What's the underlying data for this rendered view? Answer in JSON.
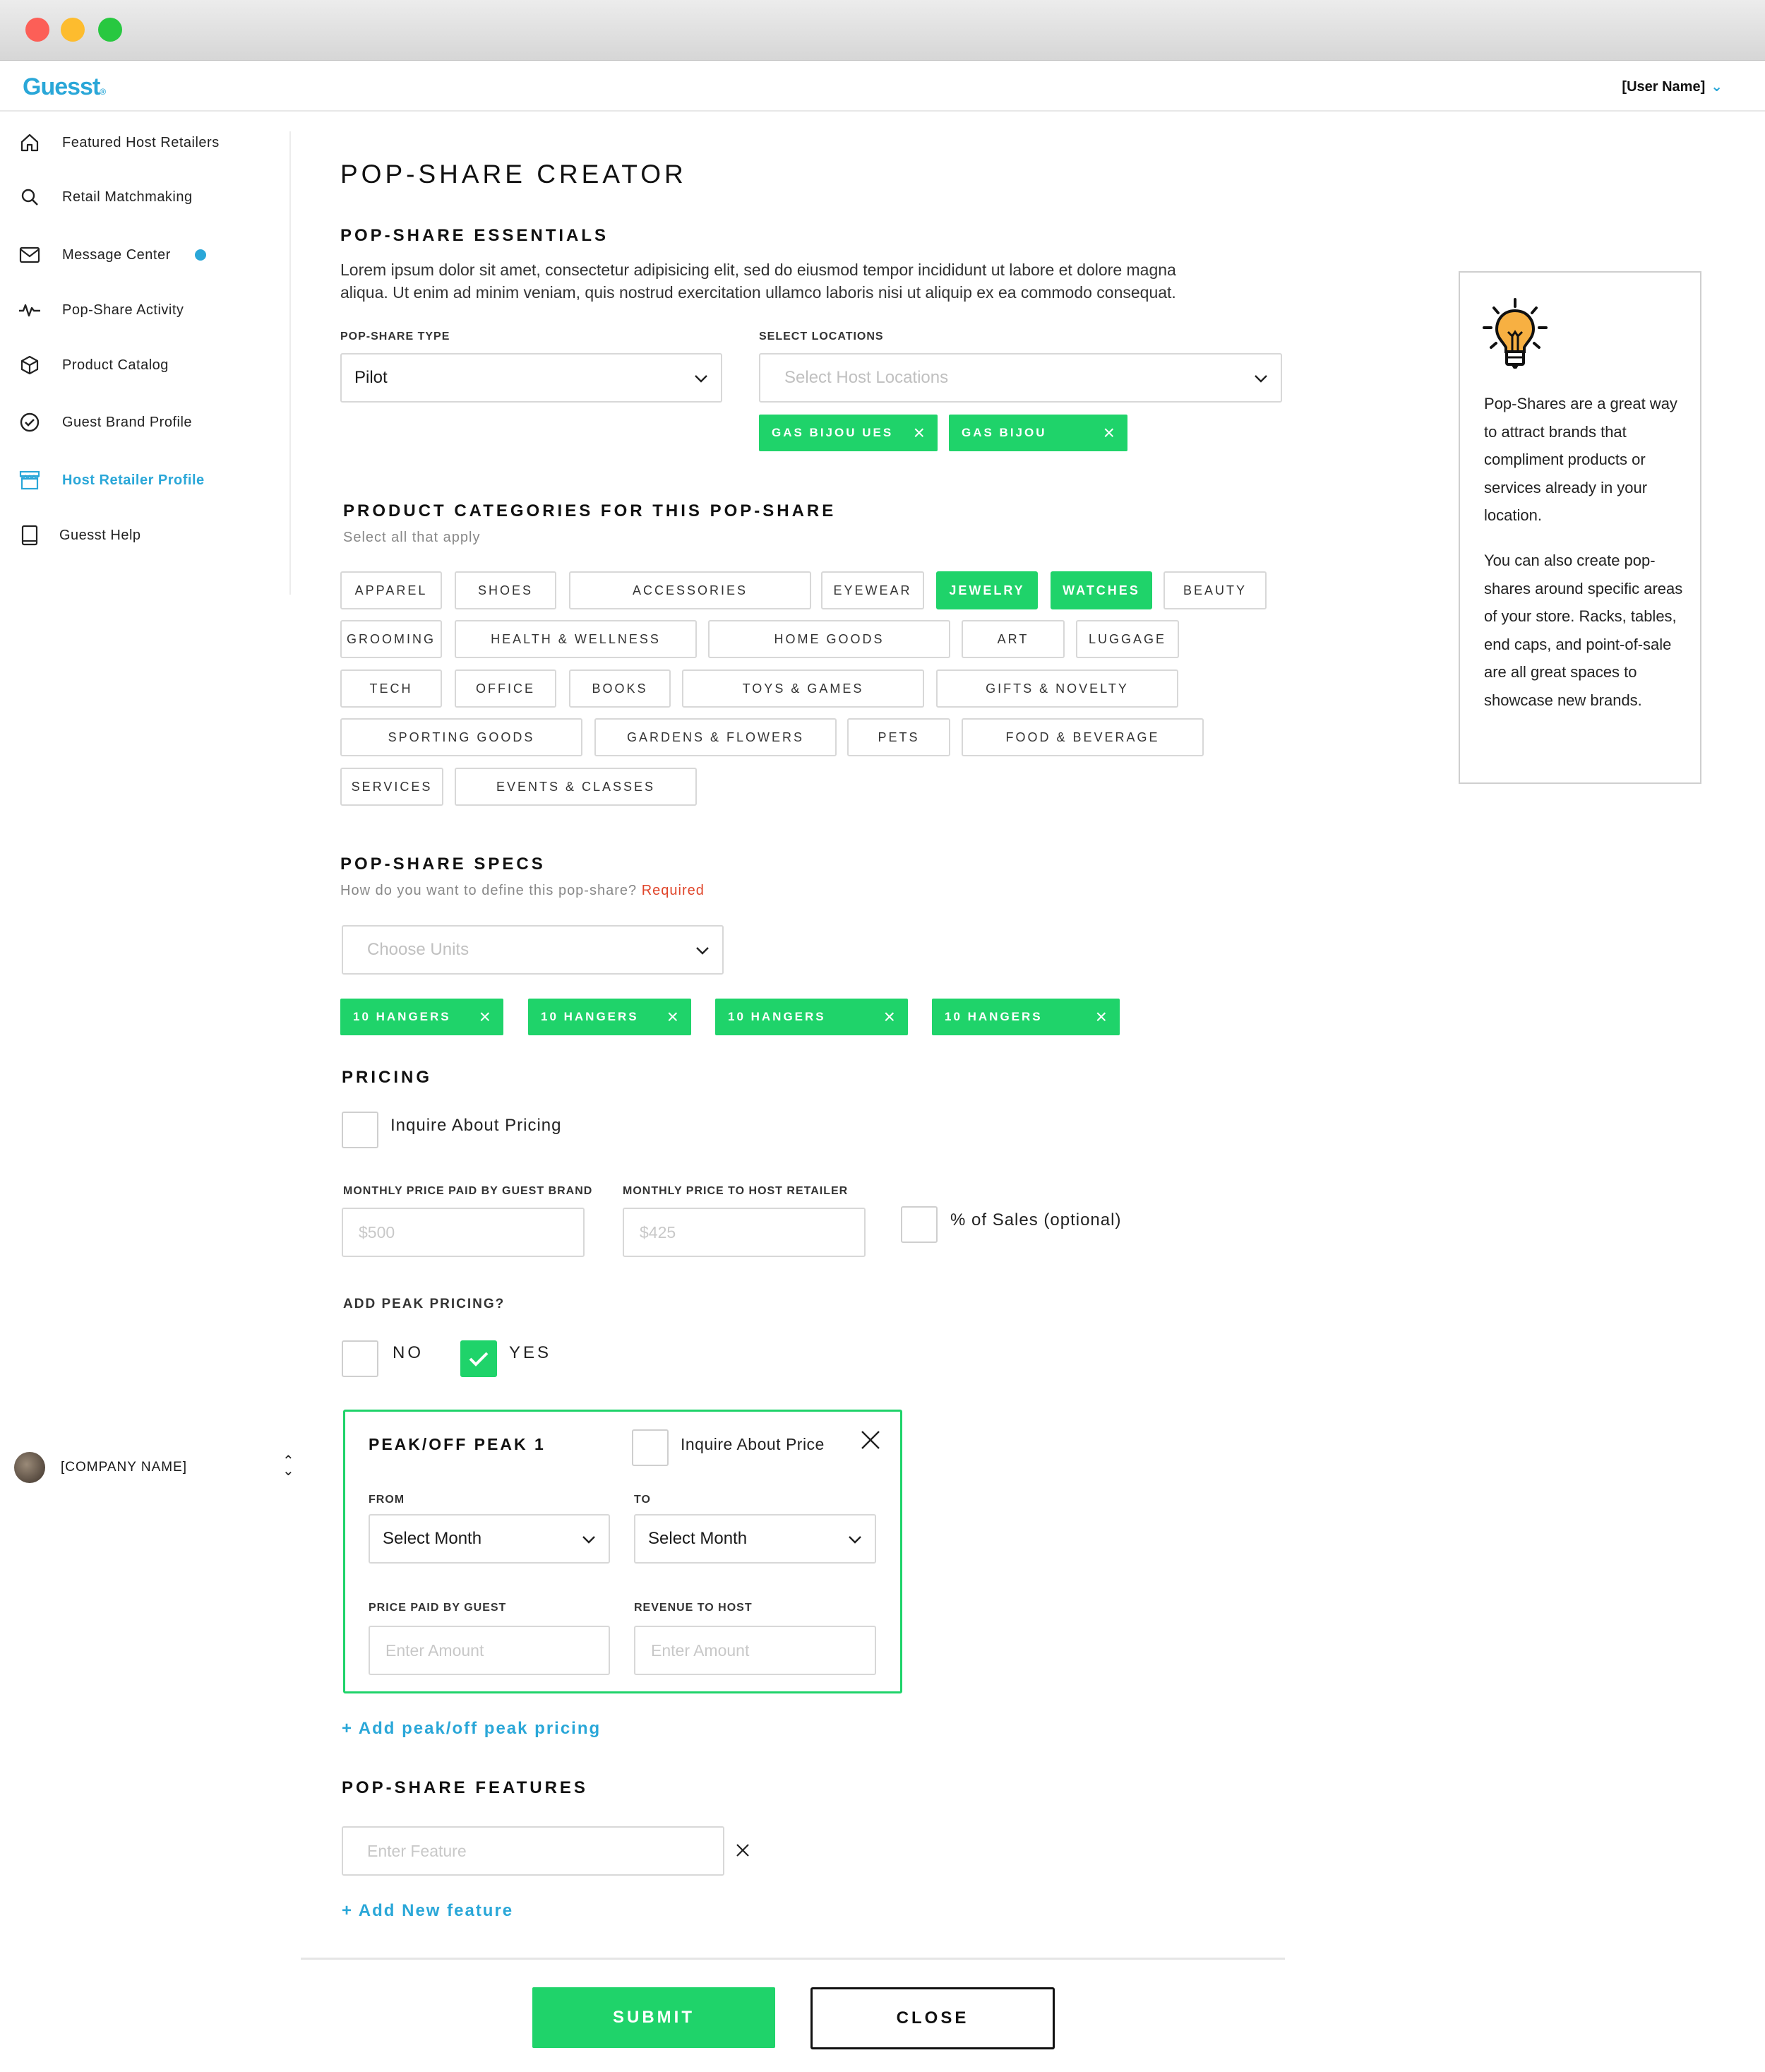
{
  "app": {
    "logo": "Guesst",
    "user_name": "[User Name]"
  },
  "sidebar": {
    "items": [
      {
        "label": "Featured Host Retailers",
        "icon": "home-icon"
      },
      {
        "label": "Retail Matchmaking",
        "icon": "search-icon"
      },
      {
        "label": "Message Center",
        "icon": "mail-icon",
        "has_badge": true
      },
      {
        "label": "Pop-Share Activity",
        "icon": "activity-icon"
      },
      {
        "label": "Product Catalog",
        "icon": "box-icon"
      },
      {
        "label": "Guest Brand Profile",
        "icon": "check-badge-icon"
      },
      {
        "label": "Host Retailer Profile",
        "icon": "storefront-icon",
        "active": true
      },
      {
        "label": "Guesst Help",
        "icon": "book-icon"
      }
    ],
    "company": "[COMPANY NAME]"
  },
  "page": {
    "title": "POP-SHARE CREATOR"
  },
  "essentials": {
    "heading": "POP-SHARE ESSENTIALS",
    "description_line1": "Lorem ipsum dolor sit amet, consectetur adipisicing elit, sed do eiusmod tempor incididunt ut labore et dolore magna",
    "description_line2": "aliqua. Ut enim ad minim veniam, quis nostrud exercitation ullamco laboris nisi ut aliquip ex ea commodo consequat.",
    "type_label": "POP-SHARE TYPE",
    "type_value": "Pilot",
    "locations_label": "SELECT LOCATIONS",
    "locations_placeholder": "Select Host Locations",
    "location_tags": [
      "GAS BIJOU UES",
      "GAS BIJOU"
    ]
  },
  "categories": {
    "heading": "PRODUCT CATEGORIES FOR THIS POP-SHARE",
    "hint": "Select all that apply",
    "items": [
      "APPAREL",
      "SHOES",
      "ACCESSORIES",
      "EYEWEAR",
      "JEWELRY",
      "WATCHES",
      "BEAUTY",
      "GROOMING",
      "HEALTH & WELLNESS",
      "HOME GOODS",
      "ART",
      "LUGGAGE",
      "TECH",
      "OFFICE",
      "BOOKS",
      "TOYS & GAMES",
      "GIFTS & NOVELTY",
      "SPORTING GOODS",
      "GARDENS & FLOWERS",
      "PETS",
      "FOOD & BEVERAGE",
      "SERVICES",
      "EVENTS & CLASSES"
    ],
    "selected": [
      "JEWELRY",
      "WATCHES"
    ]
  },
  "specs": {
    "heading": "POP-SHARE SPECS",
    "hint": "How do you want to define this pop-share?",
    "required": "Required",
    "units_placeholder": "Choose Units",
    "tags": [
      "10 HANGERS",
      "10 HANGERS",
      "10 HANGERS",
      "10 HANGERS"
    ]
  },
  "pricing": {
    "heading": "PRICING",
    "inquire_label": "Inquire About Pricing",
    "guest_label": "MONTHLY PRICE PAID BY GUEST BRAND",
    "guest_placeholder": "$500",
    "host_label": "MONTHLY PRICE TO HOST RETAILER",
    "host_placeholder": "$425",
    "sales_label": "% of Sales (optional)",
    "peak_question": "ADD PEAK PRICING?",
    "no_label": "NO",
    "yes_label": "YES",
    "peak": {
      "title": "PEAK/OFF PEAK 1",
      "inquire_label": "Inquire About Price",
      "from_label": "FROM",
      "from_value": "Select Month",
      "to_label": "TO",
      "to_value": "Select Month",
      "price_label": "PRICE PAID BY GUEST",
      "price_placeholder": "Enter Amount",
      "revenue_label": "REVENUE TO HOST",
      "revenue_placeholder": "Enter Amount"
    },
    "add_peak_link": "+ Add peak/off peak pricing"
  },
  "features": {
    "heading": "POP-SHARE FEATURES",
    "placeholder": "Enter Feature",
    "add_link": "+ Add New feature"
  },
  "tip": {
    "icon": "lightbulb-icon",
    "p1": "Pop-Shares are a great way to attract brands that compliment products or services already in your location.",
    "p2": "You can also create pop-shares around specific areas of your store. Racks, tables, end caps, and point-of-sale are all great spaces to showcase new brands."
  },
  "actions": {
    "submit": "SUBMIT",
    "close": "CLOSE"
  },
  "colors": {
    "accent_green": "#1fd36a",
    "accent_blue": "#2aa7d8",
    "required_red": "#e0452a"
  }
}
